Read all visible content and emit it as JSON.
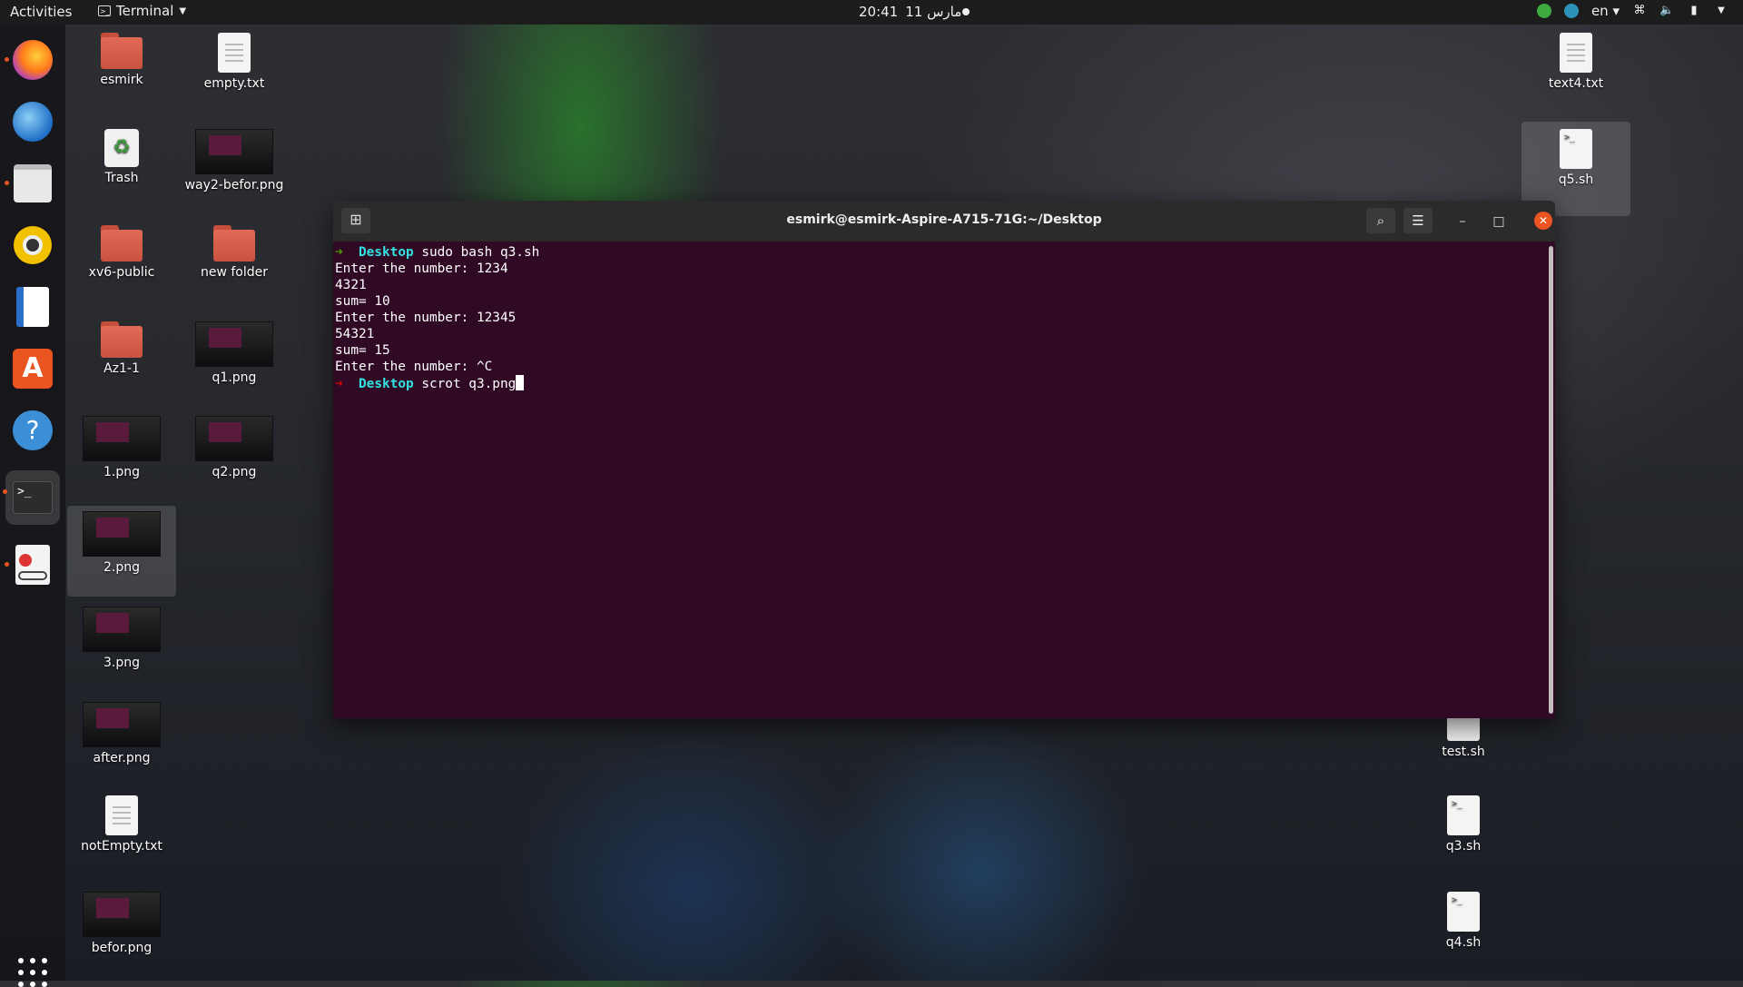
{
  "topbar": {
    "activities": "Activities",
    "app_name": "Terminal",
    "clock_time": "20:41",
    "clock_date": "11 مارس",
    "language": "en"
  },
  "dock": {
    "items": [
      {
        "name": "firefox-icon"
      },
      {
        "name": "thunderbird-icon"
      },
      {
        "name": "files-icon"
      },
      {
        "name": "rhythmbox-icon"
      },
      {
        "name": "libreoffice-writer-icon"
      },
      {
        "name": "ubuntu-software-icon"
      },
      {
        "name": "help-icon"
      },
      {
        "name": "terminal-icon"
      },
      {
        "name": "document-viewer-icon"
      }
    ]
  },
  "desktop": {
    "icons": [
      {
        "label": "esmirk"
      },
      {
        "label": "empty.txt"
      },
      {
        "label": "Trash"
      },
      {
        "label": "way2-befor.png"
      },
      {
        "label": "xv6-public"
      },
      {
        "label": "new folder"
      },
      {
        "label": "Az1-1"
      },
      {
        "label": "q1.png"
      },
      {
        "label": "1.png"
      },
      {
        "label": "q2.png"
      },
      {
        "label": "2.png"
      },
      {
        "label": "3.png"
      },
      {
        "label": "after.png"
      },
      {
        "label": "notEmpty.txt"
      },
      {
        "label": "befor.png"
      },
      {
        "label": "text4.txt"
      },
      {
        "label": "q5.sh"
      },
      {
        "label": "test.sh"
      },
      {
        "label": "q3.sh"
      },
      {
        "label": "q4.sh"
      }
    ]
  },
  "terminal": {
    "title": "esmirk@esmirk-Aspire-A715-71G:~/Desktop",
    "prompt_arrow": "➜",
    "prompt_dir": "Desktop",
    "lines": [
      {
        "kind": "prompt",
        "cmd": " sudo bash q3.sh"
      },
      {
        "kind": "out",
        "text": "Enter the number: 1234"
      },
      {
        "kind": "out",
        "text": "4321"
      },
      {
        "kind": "out",
        "text": "sum= 10"
      },
      {
        "kind": "out",
        "text": "Enter the number: 12345"
      },
      {
        "kind": "out",
        "text": "54321"
      },
      {
        "kind": "out",
        "text": "sum= 15"
      },
      {
        "kind": "out",
        "text": "Enter the number: ^C"
      },
      {
        "kind": "prompt-err",
        "cmd": " scrot q3.png"
      }
    ],
    "glyphs": {
      "new_tab": "⊞",
      "search": "⌕",
      "menu": "☰",
      "minimize": "–",
      "maximize": "□",
      "close": "✕"
    }
  },
  "colors": {
    "terminal_bg": "#300a24",
    "accent": "#e95420",
    "prompt_ok": "#4e9a06",
    "prompt_err": "#cc0000",
    "dir": "#34e2e2"
  }
}
